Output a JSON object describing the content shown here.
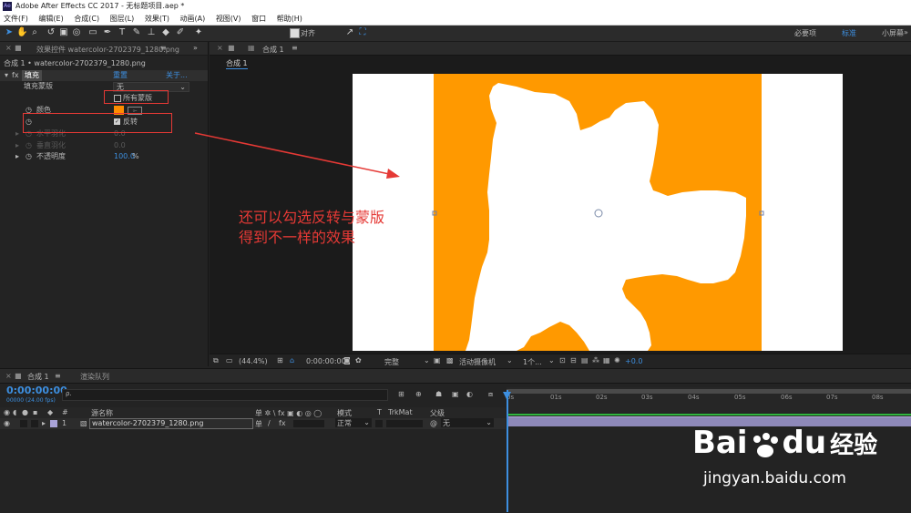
{
  "window": {
    "title": "Adobe After Effects CC 2017 - 无标题项目.aep *",
    "logo": "Ae"
  },
  "menu": [
    "文件(F)",
    "编辑(E)",
    "合成(C)",
    "图层(L)",
    "效果(T)",
    "动画(A)",
    "视图(V)",
    "窗口",
    "帮助(H)"
  ],
  "toolbar": {
    "align_label": "对齐",
    "workspaces": [
      "必要项",
      "标准",
      "小屏幕"
    ],
    "expand": "»"
  },
  "effects_panel": {
    "tab_label": "效果控件 watercolor-2702379_1280.png",
    "breadcrumb": "合成 1 • watercolor-2702379_1280.png",
    "effect_name": "填充",
    "reset": "重置",
    "about": "关于...",
    "fill_mask_label": "填充蒙版",
    "fill_mask_value": "无",
    "all_masks_label": "所有蒙版",
    "color_label": "颜色",
    "invert_label": "反转",
    "h_feather_label": "水平羽化",
    "h_feather_value": "0.0",
    "v_feather_label": "垂直羽化",
    "v_feather_value": "0.0",
    "opacity_label": "不透明度",
    "opacity_value": "100.0",
    "opacity_unit": "%",
    "fx": "fx",
    "fill_color": "#ff8c00"
  },
  "comp_panel": {
    "tab_label": "合成 1",
    "breadcrumb": "合成 1",
    "menu_icon": "≡"
  },
  "viewer_bar": {
    "zoom": "(44.4%)",
    "timecode": "0:00:00:00",
    "quality": "完整",
    "camera": "活动摄像机",
    "views": "1个...",
    "exposure": "+0.0"
  },
  "annotation": {
    "line1": "还可以勾选反转与蒙版",
    "line2": "得到不一样的效果"
  },
  "timeline": {
    "tab_label": "合成 1",
    "render_queue": "渲染队列",
    "timecode": "0:00:00:00",
    "fps_info": "00000 (24.00 fps)",
    "search_placeholder": "ρ.",
    "col_hash": "#",
    "col_source": "源名称",
    "col_switches": "单 ✲ \\ fx ▣ ◐ ◎ ◯",
    "col_mode": "模式",
    "col_t": "T",
    "col_trkmat": "TrkMat",
    "col_parent": "父级",
    "layer": {
      "index": "1",
      "name": "watercolor-2702379_1280.png",
      "mode": "正常",
      "parent": "无"
    },
    "ruler": [
      "0s",
      "01s",
      "02s",
      "03s",
      "04s",
      "05s",
      "06s",
      "07s",
      "08s"
    ]
  },
  "watermark": {
    "brand": "Bai",
    "brand2": "du",
    "suffix": "经验",
    "url": "jingyan.baidu.com"
  },
  "colors": {
    "accent": "#3d8fe0",
    "annotation": "#e53935",
    "layer_bar": "#8d88b8",
    "orange": "#ff9900"
  }
}
